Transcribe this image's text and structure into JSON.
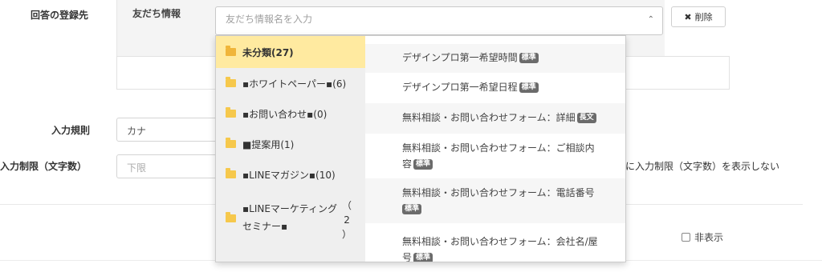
{
  "labels": {
    "answer_destination": "回答の登録先",
    "input_rule": "入力規則",
    "input_limit": "入力制限（文字数）"
  },
  "friend_info": {
    "title": "友だち情報",
    "search_placeholder": "友だち情報名を入力",
    "delete_label": "削除",
    "caret": "⌃"
  },
  "input_rule_value": "カナ",
  "lower_limit_placeholder": "下限",
  "limit_display_text": "に入力制限（文字数）を表示しない",
  "hide_label": "非表示",
  "folders": [
    {
      "label": "未分類(27)",
      "active": true
    },
    {
      "label": "▪ホワイトペーパー▪(6)"
    },
    {
      "label": "▪お問い合わせ▪(0)"
    },
    {
      "label": "■提案用(1)"
    },
    {
      "label": "▪LINEマガジン▪(10)"
    },
    {
      "label_line1": "▪LINEマーケティング",
      "label_line2": "セミナー▪",
      "count_open": "（",
      "count_num": "2",
      "count_close": "）"
    }
  ],
  "items": [
    {
      "text": "デザインプロ第一希望時間",
      "tag": "標準"
    },
    {
      "text": "デザインプロ第一希望日程",
      "tag": "標準"
    },
    {
      "text": "無料相談・お問い合わせフォーム：詳細",
      "tag": "長文"
    },
    {
      "text": "無料相談・お問い合わせフォーム：ご相談内",
      "text2": "容",
      "tag": "標準"
    },
    {
      "text": "無料相談・お問い合わせフォーム：電話番号",
      "tag": "標準"
    },
    {
      "text": "無料相談・お問い合わせフォーム：会社名/屋",
      "text2": "号",
      "tag": "標準"
    }
  ],
  "colors": {
    "active_folder_bg": "#ffeaa0",
    "folder_icon": "#f6c84c",
    "tag_bg": "#6b6b6b"
  }
}
